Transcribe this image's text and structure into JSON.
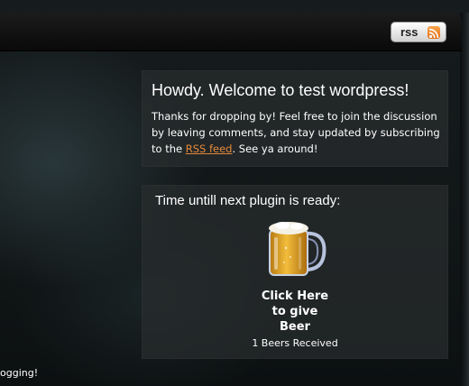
{
  "header": {
    "rss_button_label": "rss"
  },
  "welcome": {
    "title": "Howdy. Welcome to test wordpress!",
    "text_before_link": "Thanks for dropping by! Feel free to join the discussion by leaving comments, and stay updated by subscribing to the ",
    "link_text": "RSS feed",
    "text_after_link": ". See ya around!"
  },
  "plugin_widget": {
    "heading": "Time untill next plugin is ready:",
    "cta_lines": [
      "Click Here",
      "to give",
      "Beer"
    ],
    "beers_received": "1 Beers Received"
  },
  "left_fragment": "ogging!",
  "colors": {
    "link": "#e38a3c",
    "rss_icon": "#f08a2a"
  },
  "icons": [
    "rss-feed-icon",
    "beer-mug-icon"
  ]
}
